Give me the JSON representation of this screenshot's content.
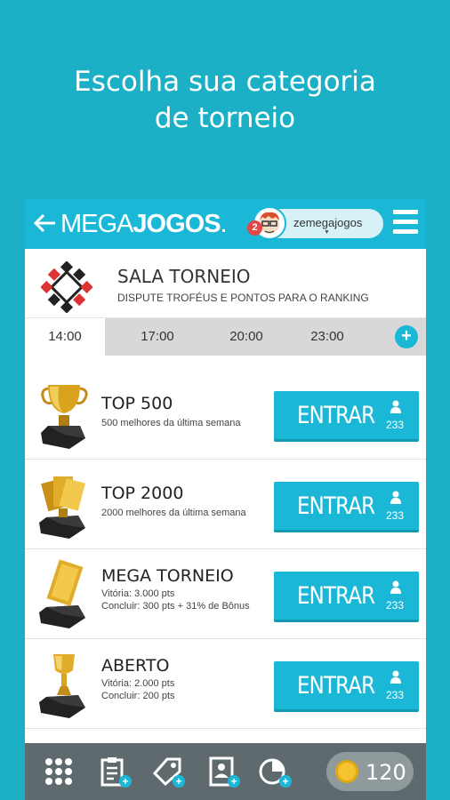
{
  "headline": {
    "line1": "Escolha sua categoria",
    "line2": "de torneio"
  },
  "app": {
    "logo_light": "MEGA",
    "logo_bold": "JOGOS",
    "logo_suffix": ".",
    "username": "zemegajogos",
    "notification_count": "2",
    "back_icon": "arrow-left-icon",
    "menu_icon": "hamburger-menu-icon"
  },
  "sala": {
    "title": "SALA TORNEIO",
    "subtitle": "DISPUTE TROFÉUS E PONTOS PARA O RANKING"
  },
  "tabs": [
    {
      "label": "14:00",
      "active": true
    },
    {
      "label": "17:00",
      "active": false
    },
    {
      "label": "20:00",
      "active": false
    },
    {
      "label": "23:00",
      "active": false
    }
  ],
  "tournaments": [
    {
      "title": "TOP 500",
      "desc1": "500 melhores da última semana",
      "desc2": "",
      "button": "ENTRAR",
      "players": "233"
    },
    {
      "title": "TOP 2000",
      "desc1": "2000 melhores da última semana",
      "desc2": "",
      "button": "ENTRAR",
      "players": "233"
    },
    {
      "title": "MEGA TORNEIO",
      "desc1": "Vitória: 3.000 pts",
      "desc2": "Concluir: 300 pts  +  31% de Bônus",
      "button": "ENTRAR",
      "players": "233"
    },
    {
      "title": "ABERTO",
      "desc1": "Vitória: 2.000 pts",
      "desc2": "Concluir: 200 pts",
      "button": "ENTRAR",
      "players": "233"
    }
  ],
  "bottom_bar": {
    "icons": [
      "grid-icon",
      "clipboard-plus-icon",
      "tag-plus-icon",
      "profile-card-plus-icon",
      "pie-chart-plus-icon"
    ],
    "coins": "120"
  },
  "colors": {
    "background": "#1bb0c6",
    "accent": "#1ab8d6",
    "bottom_bar": "#5e6a6d"
  }
}
